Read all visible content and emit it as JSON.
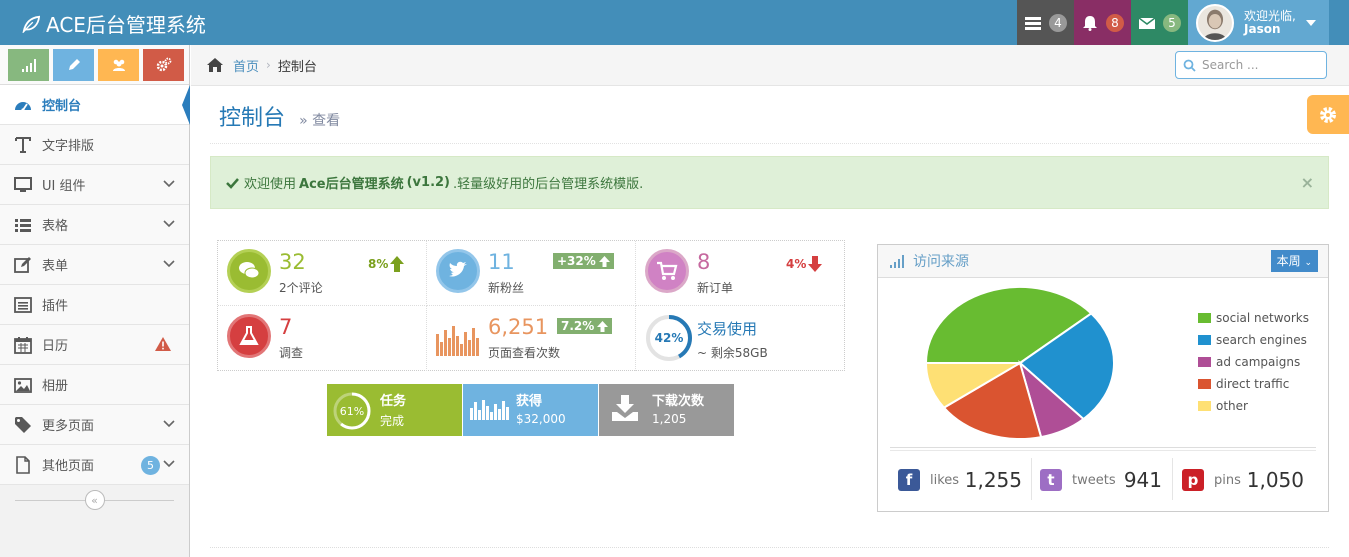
{
  "navbar": {
    "brand": "ACE后台管理系统",
    "tasks_badge": "4",
    "notify_badge": "8",
    "messages_badge": "5",
    "welcome": "欢迎光临,",
    "username": "Jason",
    "colors": {
      "tasks": "#555555",
      "notify": "#892e65",
      "messages": "#2e8965",
      "user": "#62a8d1"
    }
  },
  "sidebar": {
    "shortcuts": [
      {
        "icon": "signal-icon",
        "color": "#87b87f"
      },
      {
        "icon": "pencil-icon",
        "color": "#6fb3e0"
      },
      {
        "icon": "users-icon",
        "color": "#ffb752"
      },
      {
        "icon": "cogs-icon",
        "color": "#d15b47"
      }
    ],
    "items": [
      {
        "label": "控制台",
        "icon": "dashboard-icon"
      },
      {
        "label": "文字排版",
        "icon": "text-icon"
      },
      {
        "label": "UI 组件",
        "icon": "desktop-icon"
      },
      {
        "label": "表格",
        "icon": "list-icon"
      },
      {
        "label": "表单",
        "icon": "edit-icon"
      },
      {
        "label": "插件",
        "icon": "list-alt-icon"
      },
      {
        "label": "日历",
        "icon": "calendar-icon"
      },
      {
        "label": "相册",
        "icon": "picture-icon"
      },
      {
        "label": "更多页面",
        "icon": "tag-icon"
      },
      {
        "label": "其他页面",
        "icon": "file-icon",
        "badge": "5"
      }
    ]
  },
  "breadcrumb": {
    "home": "首页",
    "current": "控制台"
  },
  "search": {
    "placeholder": "Search ..."
  },
  "page": {
    "title": "控制台",
    "subtitle": "查看"
  },
  "alert": {
    "prefix": "欢迎使用",
    "product": "Ace后台管理系统",
    "version": "(v1.2)",
    "suffix": ".轻量级好用的后台管理系统模版."
  },
  "stats": [
    {
      "value": "32",
      "caption": "2个评论",
      "change": "8%",
      "color": "#9abc32"
    },
    {
      "value": "11",
      "caption": "新粉丝",
      "change": "+32%",
      "color": "#6fb3e0"
    },
    {
      "value": "8",
      "caption": "新订单",
      "change": "4%",
      "color": "#c6699f"
    },
    {
      "value": "7",
      "caption": "调查",
      "color": "#d53f40"
    },
    {
      "value": "6,251",
      "caption": "页面查看次数",
      "change": "7.2%",
      "color": "#e8955f"
    },
    {
      "value": "42%",
      "label": "交易使用",
      "caption": "~ 剩余58GB",
      "color": "#2679b5",
      "progress": 0.42
    }
  ],
  "tiles": [
    {
      "title": "任务",
      "subtitle": "完成",
      "value": "61%",
      "progress": 0.61,
      "color": "#9abc32"
    },
    {
      "title": "获得",
      "subtitle": "$32,000",
      "color": "#6fb3e0"
    },
    {
      "title": "下载次数",
      "subtitle": "1,205",
      "color": "#999999"
    }
  ],
  "widget": {
    "title": "访问来源",
    "range_button": "本周",
    "legend": [
      {
        "label": "social networks",
        "color": "#68bc31"
      },
      {
        "label": "search engines",
        "color": "#2091cf"
      },
      {
        "label": "ad campaigns",
        "color": "#af4e96"
      },
      {
        "label": "direct traffic",
        "color": "#da5430"
      },
      {
        "label": "other",
        "color": "#fee074"
      }
    ],
    "social": [
      {
        "label": "likes",
        "value": "1,255",
        "color": "#3b5998"
      },
      {
        "label": "tweets",
        "value": "941",
        "color": "#9d6ec4"
      },
      {
        "label": "pins",
        "value": "1,050",
        "color": "#cb2027"
      }
    ]
  },
  "chart_data": {
    "type": "pie",
    "categories": [
      "social networks",
      "search engines",
      "ad campaigns",
      "direct traffic",
      "other"
    ],
    "values": [
      38.7,
      24.5,
      8.2,
      18.6,
      10
    ],
    "colors": [
      "#68bc31",
      "#2091cf",
      "#af4e96",
      "#da5430",
      "#fee074"
    ]
  }
}
